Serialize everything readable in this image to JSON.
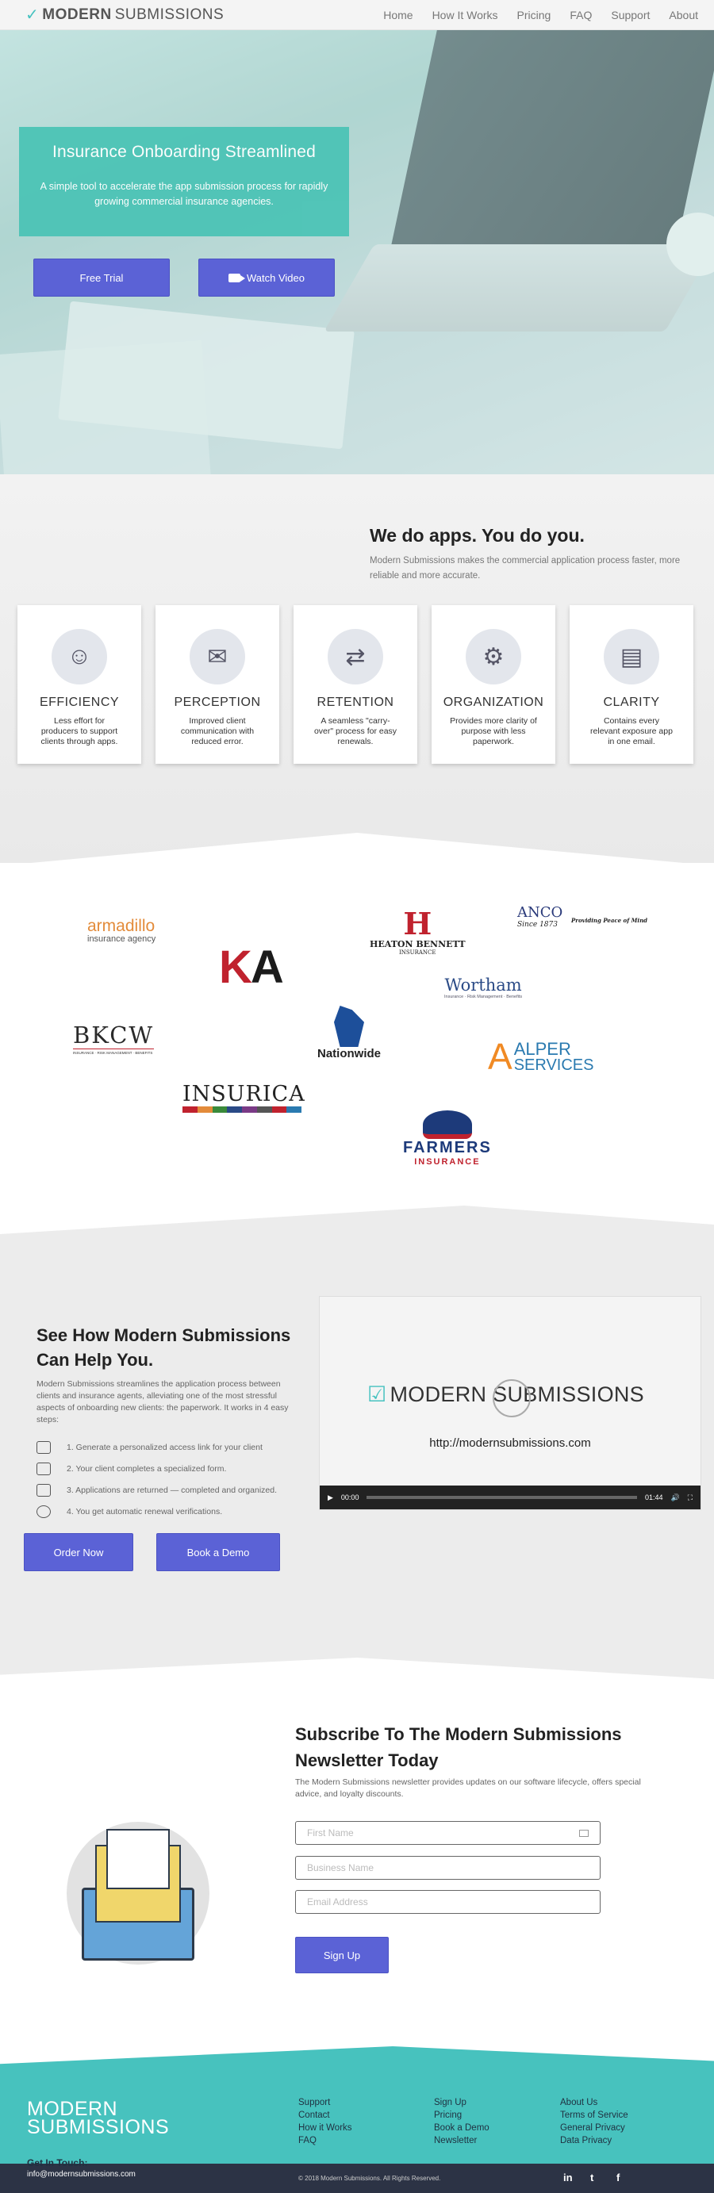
{
  "nav": {
    "logo_bold": "MODERN",
    "logo_rest": "SUBMISSIONS",
    "items": [
      "Home",
      "How It Works",
      "Pricing",
      "FAQ",
      "Support",
      "About"
    ]
  },
  "hero": {
    "title": "Insurance Onboarding Streamlined",
    "subtitle": "A simple tool to accelerate the app submission process for rapidly growing commercial insurance agencies.",
    "free_trial": "Free Trial",
    "watch_video": "Watch Video"
  },
  "apps": {
    "title": "We do apps. You do you.",
    "subtitle": "Modern Submissions makes the commercial application process faster, more reliable and more accurate.",
    "cards": [
      {
        "title": "EFFICIENCY",
        "text": "Less effort for producers to support clients through apps."
      },
      {
        "title": "PERCEPTION",
        "text": "Improved client communication with reduced error."
      },
      {
        "title": "RETENTION",
        "text": "A seamless \"carry-over\" process for easy renewals."
      },
      {
        "title": "ORGANIZATION",
        "text": "Provides more clarity of purpose with less paperwork."
      },
      {
        "title": "CLARITY",
        "text": "Contains every relevant exposure app in one email."
      }
    ]
  },
  "logos": {
    "armadillo": "armadillo",
    "armadillo_sub": "insurance agency",
    "ka": "KA",
    "heaton": "HEATON BENNETT",
    "heaton_sub": "INSURANCE",
    "anco": "ANCO",
    "anco_sub": "Since 1873",
    "anco_tag": "Providing Peace of Mind",
    "wortham": "Wortham",
    "wortham_sub": "Insurance · Risk Management · Benefits",
    "bkcw": "BKCW",
    "bkcw_sub": "INSURANCE · RISK MANAGEMENT · BENEFITS",
    "nationwide": "Nationwide",
    "alper": "ALPER",
    "alper_sub": "SERVICES",
    "insurica": "INSURICA",
    "farmers": "FARMERS",
    "farmers_sub": "INSURANCE"
  },
  "help": {
    "title": "See How Modern Submissions Can Help You.",
    "subtitle": "Modern Submissions streamlines the application process between clients and insurance agents, alleviating one of the most stressful aspects of onboarding new clients: the paperwork. It works in 4 easy steps:",
    "steps": [
      "1. Generate a personalized access link for your client",
      "2. Your client completes a specialized form.",
      "3. Applications are returned — completed and organized.",
      "4. You get automatic renewal verifications."
    ],
    "order": "Order Now",
    "demo": "Book a Demo",
    "video": {
      "logo_a": "MODERN",
      "logo_b": "SUBMISSIONS",
      "url": "http://modernsubmissions.com",
      "time_now": "00:00",
      "time_total": "01:44",
      "progress": 0
    }
  },
  "news": {
    "title": "Subscribe To The Modern Submissions Newsletter Today",
    "subtitle": "The Modern Submissions newsletter provides updates on our software lifecycle, offers special advice, and loyalty discounts.",
    "first": "First Name",
    "business": "Business Name",
    "email": "Email Address",
    "signup": "Sign Up"
  },
  "footer": {
    "logo_a": "MODERN",
    "logo_b": "SUBMISSIONS",
    "col1": [
      "Support",
      "Contact",
      "How it Works",
      "FAQ"
    ],
    "col2": [
      "Sign Up",
      "Pricing",
      "Book a Demo",
      "Newsletter"
    ],
    "col3": [
      "About Us",
      "Terms of Service",
      "General Privacy",
      "Data Privacy"
    ],
    "get_in_touch": "Get In Touch:",
    "email": "info@modernsubmissions.com",
    "copyright": "© 2018 Modern Submissions. All Rights Reserved.",
    "social": [
      "in",
      "t",
      "f"
    ]
  },
  "colors": {
    "teal": "#47c2be",
    "button": "#5b62d6",
    "dark": "#2c3345"
  }
}
